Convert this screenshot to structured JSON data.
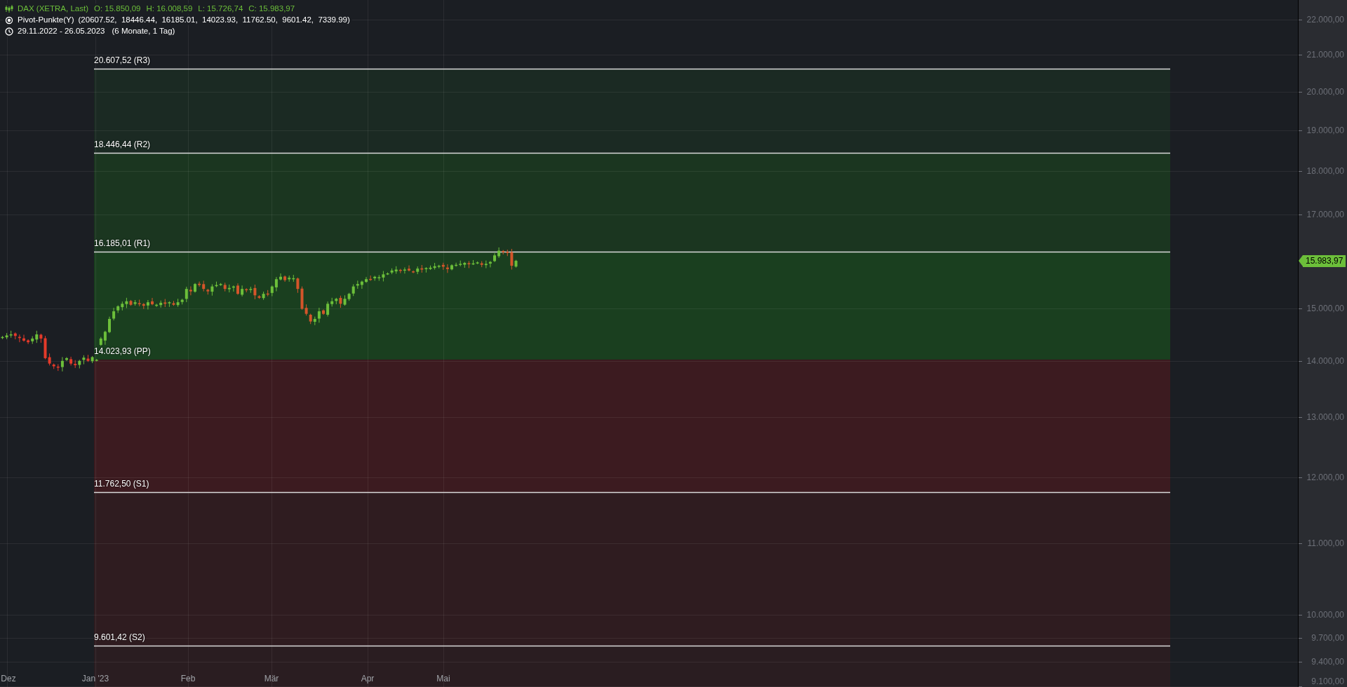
{
  "legend": {
    "instrument": "DAX (XETRA, Last)",
    "ohlc": [
      "O: 15.850,09",
      "H: 16.008,59",
      "L: 15.726,74",
      "C: 15.983,97"
    ],
    "indicator": "Pivot-Punkte(Y)",
    "indicator_values": "(20607.52,  18446.44,  16185.01,  14023.93,  11762.50,  9601.42,  7339.99)",
    "period": "29.11.2022 - 26.05.2023",
    "period_note": "(6 Monate, 1 Tag)"
  },
  "pivot_levels": [
    {
      "label": "20.607,52 (R3)",
      "kind": "resistance"
    },
    {
      "label": "18.446,44 (R2)",
      "kind": "resistance",
      "color": "#1b2a23"
    },
    {
      "label": "16.185,01 (R1)",
      "kind": "resistance",
      "color": "#1b3620"
    },
    {
      "label": "14.023,93 (PP)",
      "kind": "pivot",
      "color": "#1a3f1f"
    },
    {
      "label": "11.762,50 (S1)",
      "kind": "support",
      "color": "#3c1b20"
    },
    {
      "label": "9.601,42 (S2)",
      "kind": "support",
      "color": "#2f1c20"
    }
  ],
  "lowest_zone": {
    "color": "#2a1d21"
  },
  "y_axis": {
    "ticks": [
      "22.000,00",
      "21.000,00",
      "20.000,00",
      "19.000,00",
      "18.000,00",
      "17.000,00",
      "15.000,00",
      "14.000,00",
      "13.000,00",
      "12.000,00",
      "11.000,00",
      "10.000,00",
      "9.700,00",
      "9.400,00",
      "9.100,00"
    ],
    "last_price": "15.983,97"
  },
  "x_axis": {
    "labels": [
      "Dez",
      "Jan '23",
      "Feb",
      "Mär",
      "Apr",
      "Mai"
    ]
  }
}
